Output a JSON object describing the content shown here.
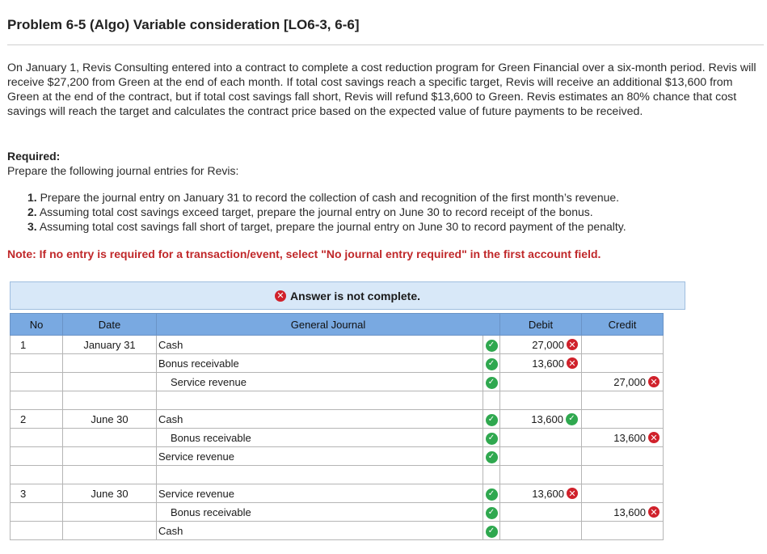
{
  "title": "Problem 6-5 (Algo) Variable consideration [LO6-3, 6-6]",
  "intro": "On January 1, Revis Consulting entered into a contract to complete a cost reduction program for Green Financial over a six-month period. Revis will receive $27,200 from Green at the end of each month. If total cost savings reach a specific target, Revis will receive an additional $13,600 from Green at the end of the contract, but if total cost savings fall short, Revis will refund $13,600 to Green. Revis estimates an 80% chance that cost savings will reach the target and calculates the contract price based on the expected value of future payments to be received.",
  "required_label": "Required:",
  "required_text": "Prepare the following journal entries for Revis:",
  "requirements": [
    {
      "num": "1.",
      "text": "Prepare the journal entry on January 31 to record the collection of cash and recognition of the first month’s revenue."
    },
    {
      "num": "2.",
      "text": "Assuming total cost savings exceed target, prepare the journal entry on June 30 to record receipt of the bonus."
    },
    {
      "num": "3.",
      "text": "Assuming total cost savings fall short of target, prepare the journal entry on June 30 to record payment of the penalty."
    }
  ],
  "note": "Note: If no entry is required for a transaction/event, select \"No journal entry required\" in the first account field.",
  "banner": "Answer is not complete.",
  "headers": {
    "no": "No",
    "date": "Date",
    "account": "General Journal",
    "debit": "Debit",
    "credit": "Credit"
  },
  "rows": [
    {
      "no": "1",
      "date": "January 31",
      "account": "Cash",
      "indent": false,
      "debit": "27,000",
      "debit_status": "wrong",
      "credit": "",
      "credit_status": ""
    },
    {
      "no": "",
      "date": "",
      "account": "Bonus receivable",
      "indent": false,
      "debit": "13,600",
      "debit_status": "wrong",
      "credit": "",
      "credit_status": ""
    },
    {
      "no": "",
      "date": "",
      "account": "Service revenue",
      "indent": true,
      "debit": "",
      "debit_status": "",
      "credit": "27,000",
      "credit_status": "wrong"
    },
    {
      "no": "2",
      "date": "June 30",
      "account": "Cash",
      "indent": false,
      "debit": "13,600",
      "debit_status": "right",
      "credit": "",
      "credit_status": ""
    },
    {
      "no": "",
      "date": "",
      "account": "Bonus receivable",
      "indent": true,
      "debit": "",
      "debit_status": "",
      "credit": "13,600",
      "credit_status": "wrong"
    },
    {
      "no": "",
      "date": "",
      "account": "Service revenue",
      "indent": false,
      "debit": "",
      "debit_status": "",
      "credit": "",
      "credit_status": ""
    },
    {
      "no": "3",
      "date": "June 30",
      "account": "Service revenue",
      "indent": false,
      "debit": "13,600",
      "debit_status": "wrong",
      "credit": "",
      "credit_status": ""
    },
    {
      "no": "",
      "date": "",
      "account": "Bonus receivable",
      "indent": true,
      "debit": "",
      "debit_status": "",
      "credit": "13,600",
      "credit_status": "wrong"
    },
    {
      "no": "",
      "date": "",
      "account": "Cash",
      "indent": false,
      "debit": "",
      "debit_status": "",
      "credit": "",
      "credit_status": ""
    }
  ],
  "icons": {
    "correct": "check-icon",
    "incorrect": "x-icon"
  },
  "colors": {
    "header_bg": "#79a9e1",
    "banner_bg": "#d8e8f8",
    "note_red": "#c0282a",
    "check_green": "#2fa84f",
    "x_red": "#d0212b"
  }
}
